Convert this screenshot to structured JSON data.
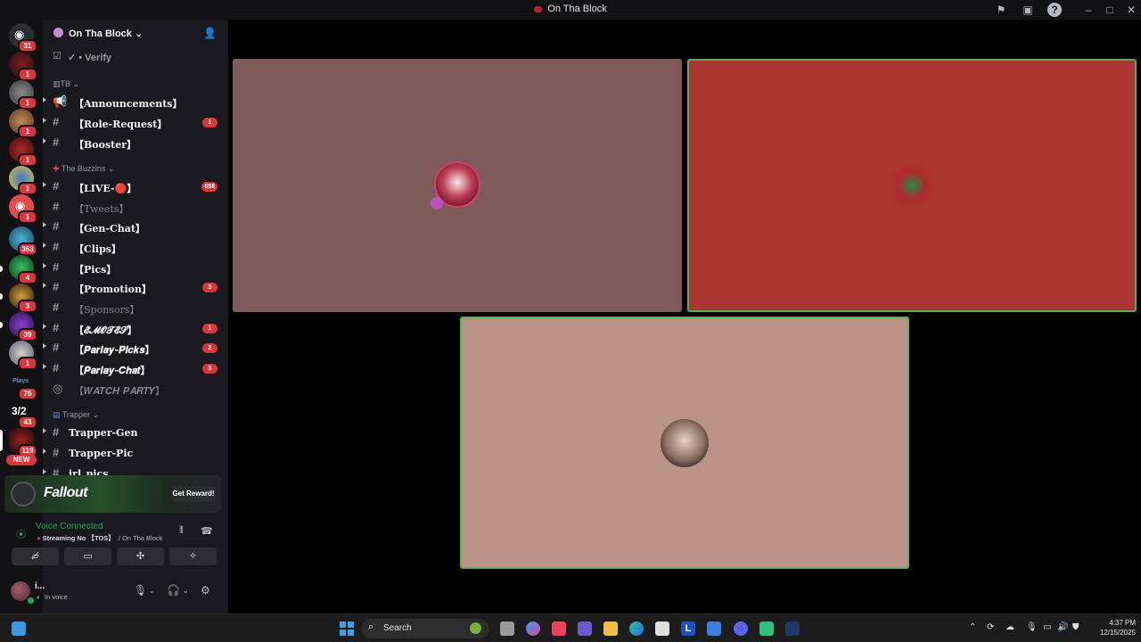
{
  "window": {
    "title": "On Tha Block"
  },
  "server": {
    "name": "On Tha Block"
  },
  "verify": {
    "label": "✓ • Verify"
  },
  "rail": {
    "badges": [
      "31",
      "1",
      "1",
      "1",
      "1",
      "1",
      "1",
      "363",
      "4",
      "3",
      "39",
      "1",
      "76",
      "43",
      "119"
    ],
    "new_label": "NEW"
  },
  "categories": {
    "tb": "TB",
    "buzzins": "The Buzzins",
    "trapper": "Trapper"
  },
  "channels": [
    {
      "name": "【Announcements】",
      "count": ""
    },
    {
      "name": "【Role-Request】",
      "count": "1"
    },
    {
      "name": "【Booster】",
      "count": ""
    },
    {
      "name": "【LIVE-🔴】",
      "count": "658"
    },
    {
      "name": "【Tweets】",
      "count": ""
    },
    {
      "name": "【Gen-Chat】",
      "count": ""
    },
    {
      "name": "【Clips】",
      "count": ""
    },
    {
      "name": "【Pics】",
      "count": ""
    },
    {
      "name": "【Promotion】",
      "count": "3"
    },
    {
      "name": "【Sponsors】",
      "count": ""
    },
    {
      "name": "【𝓔𝓜𝓞𝓣𝓔𝓢】",
      "count": "1"
    },
    {
      "name": "【𝑷𝒂𝒓𝒍𝒂𝒚-𝑷𝒊𝒄𝒌𝒔】",
      "count": "2"
    },
    {
      "name": "【𝑷𝒂𝒓𝒍𝒂𝒚-𝑪𝒉𝒂𝒕】",
      "count": "3"
    },
    {
      "name": "【𝑾𝑨𝑻𝑪𝑯 𝑷𝑨𝑹𝑻𝒀】",
      "count": ""
    },
    {
      "name": "Trapper-Gen",
      "count": ""
    },
    {
      "name": "Trapper-Pic",
      "count": ""
    },
    {
      "name": "irl_pics",
      "count": ""
    }
  ],
  "promo": {
    "title": "Fallout",
    "button": "Get Reward!"
  },
  "voice": {
    "status": "Voice Connected",
    "streaming": "Streaming No 【TOS】",
    "server": "/ On Tha Block"
  },
  "user": {
    "name": "i...",
    "status": "In voice"
  },
  "tiles": {
    "tile1_color": "#7f5a5a",
    "tile2_color": "#a83531",
    "tile3_color": "#bb9487",
    "speaking_border": "#5fae52"
  },
  "taskbar": {
    "search_placeholder": "Search",
    "time": "4:37 PM",
    "date": "12/15/2025"
  }
}
